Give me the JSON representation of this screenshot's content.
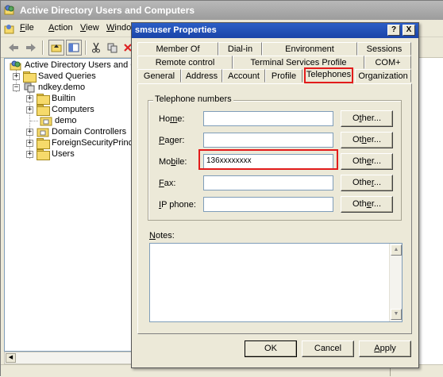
{
  "mmc": {
    "title": "Active Directory Users and Computers",
    "menu": [
      {
        "label": "File",
        "hotkey": "F",
        "rest": "ile"
      },
      {
        "label": "Action",
        "hotkey": "A",
        "rest": "ction"
      },
      {
        "label": "View",
        "hotkey": "V",
        "rest": "iew"
      },
      {
        "label": "Window",
        "hotkey": "W",
        "rest": "indow"
      }
    ],
    "tree": {
      "root": "Active Directory Users and Com",
      "saved_queries": "Saved Queries",
      "domain": "ndkey.demo",
      "builtin": "Builtin",
      "computers": "Computers",
      "demo": "demo",
      "domain_controllers": "Domain Controllers",
      "foreign": "ForeignSecurityPrincipal",
      "users": "Users"
    }
  },
  "dialog": {
    "title": "smsuser Properties",
    "help_button": "?",
    "close_button": "X",
    "tabs_row1": [
      "Member Of",
      "Dial-in",
      "Environment",
      "Sessions"
    ],
    "tabs_row2": [
      "Remote control",
      "Terminal Services Profile",
      "COM+"
    ],
    "tabs_row3": [
      "General",
      "Address",
      "Account",
      "Profile",
      "Telephones",
      "Organization"
    ],
    "active_tab": "Telephones",
    "group_title": "Telephone numbers",
    "rows": [
      {
        "label_hotkey": "m",
        "label_pre": "Ho",
        "label_post": "e:",
        "value": "",
        "other_pre": "O",
        "other_hotkey": "t",
        "other_post": "her..."
      },
      {
        "label_hotkey": "P",
        "label_pre": "",
        "label_post": "ager:",
        "value": "",
        "other_pre": "Ot",
        "other_hotkey": "h",
        "other_post": "er..."
      },
      {
        "label_hotkey": "b",
        "label_pre": "Mo",
        "label_post": "ile:",
        "value": "136xxxxxxxx",
        "other_pre": "Oth",
        "other_hotkey": "e",
        "other_post": "r..."
      },
      {
        "label_hotkey": "F",
        "label_pre": "",
        "label_post": "ax:",
        "value": "",
        "other_pre": "Othe",
        "other_hotkey": "r",
        "other_post": "..."
      },
      {
        "label_hotkey": "I",
        "label_pre": "",
        "label_post": "P phone:",
        "value": "",
        "other_pre": "Oth",
        "other_hotkey": "e",
        "other_post": "r..."
      }
    ],
    "notes_label_pre": "",
    "notes_label_hotkey": "N",
    "notes_label_post": "otes:",
    "notes_value": "",
    "ok": "OK",
    "cancel": "Cancel",
    "apply_hotkey": "A",
    "apply_rest": "pply",
    "highlight_color": "#e21b1b",
    "titlebar_color": "#2c5fc6"
  }
}
